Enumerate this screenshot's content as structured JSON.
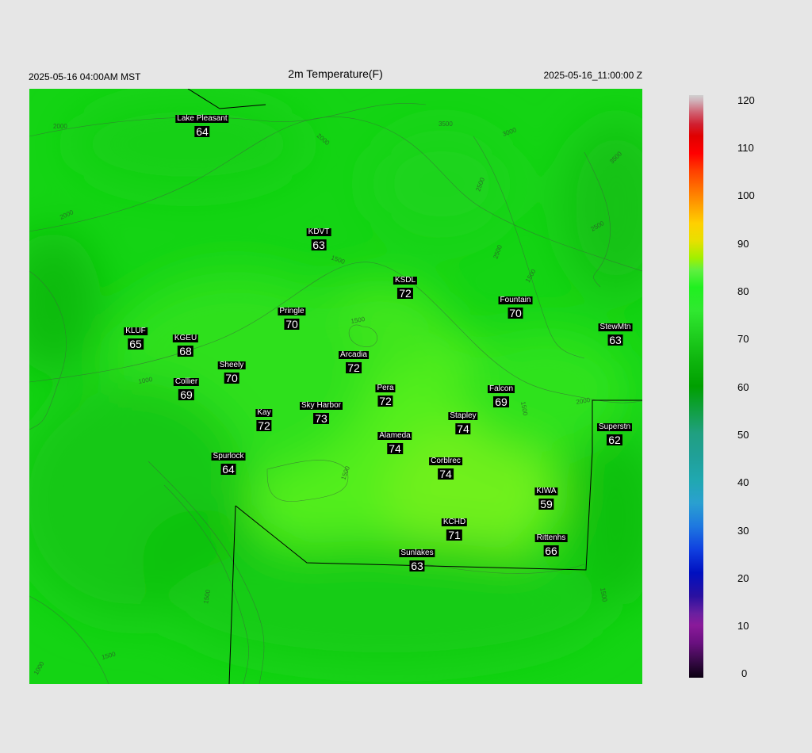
{
  "header": {
    "left_time": "2025-05-16 04:00AM MST",
    "title": "2m Temperature(F)",
    "right_time": "2025-05-16_11:00:00 Z"
  },
  "stations": [
    {
      "name": "Lake Pleasant",
      "value": "64"
    },
    {
      "name": "KDVT",
      "value": "63"
    },
    {
      "name": "KSDL",
      "value": "72"
    },
    {
      "name": "Pringle",
      "value": "70"
    },
    {
      "name": "Fountain",
      "value": "70"
    },
    {
      "name": "KLUF",
      "value": "65"
    },
    {
      "name": "KGEU",
      "value": "68"
    },
    {
      "name": "StewMtn",
      "value": "63"
    },
    {
      "name": "Arcadia",
      "value": "72"
    },
    {
      "name": "Sheely",
      "value": "70"
    },
    {
      "name": "Collier",
      "value": "69"
    },
    {
      "name": "Pera",
      "value": "72"
    },
    {
      "name": "Falcon",
      "value": "69"
    },
    {
      "name": "Sky Harbor",
      "value": "73"
    },
    {
      "name": "Kay",
      "value": "72"
    },
    {
      "name": "Stapley",
      "value": "74"
    },
    {
      "name": "Superstn",
      "value": "62"
    },
    {
      "name": "Alameda",
      "value": "74"
    },
    {
      "name": "Spurlock",
      "value": "64"
    },
    {
      "name": "Corblrec",
      "value": "74"
    },
    {
      "name": "KIWA",
      "value": "59"
    },
    {
      "name": "KCHD",
      "value": "71"
    },
    {
      "name": "Rittenhs",
      "value": "66"
    },
    {
      "name": "Sunlakes",
      "value": "63"
    }
  ],
  "contour_labels": [
    "2000",
    "2000",
    "3500",
    "3000",
    "2500",
    "3500",
    "2500",
    "2000",
    "2500",
    "1500",
    "1500",
    "1000",
    "2000",
    "1500",
    "1500",
    "1500",
    "1500",
    "1500",
    "1500",
    "1000"
  ],
  "colorbar": {
    "ticks": [
      "120",
      "110",
      "100",
      "90",
      "80",
      "70",
      "60",
      "50",
      "40",
      "30",
      "20",
      "10",
      "0"
    ]
  }
}
